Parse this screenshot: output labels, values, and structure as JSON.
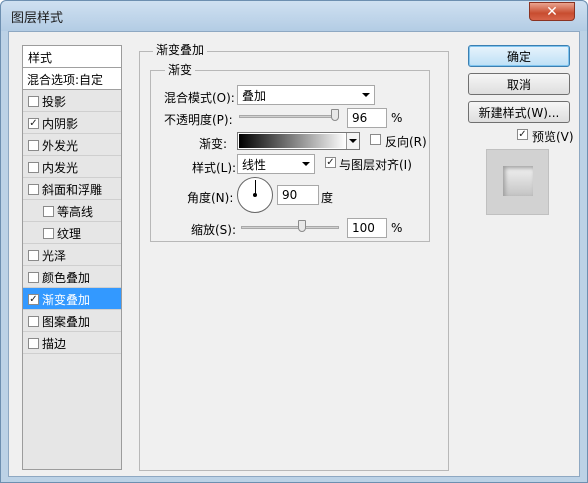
{
  "window": {
    "title": "图层样式",
    "close_glyph": "✕"
  },
  "sidebar": {
    "header": "样式",
    "blend_options": "混合选项:自定",
    "items": [
      {
        "label": "投影",
        "checked": false
      },
      {
        "label": "内阴影",
        "checked": true
      },
      {
        "label": "外发光",
        "checked": false
      },
      {
        "label": "内发光",
        "checked": false
      },
      {
        "label": "斜面和浮雕",
        "checked": false
      },
      {
        "label": "等高线",
        "checked": false
      },
      {
        "label": "纹理",
        "checked": false
      },
      {
        "label": "光泽",
        "checked": false
      },
      {
        "label": "颜色叠加",
        "checked": false
      },
      {
        "label": "渐变叠加",
        "checked": true,
        "selected": true
      },
      {
        "label": "图案叠加",
        "checked": false
      },
      {
        "label": "描边",
        "checked": false
      }
    ]
  },
  "panel": {
    "group_title": "渐变叠加",
    "subgroup_title": "渐变",
    "blend_mode_label": "混合模式(O):",
    "blend_mode_value": "叠加",
    "opacity_label": "不透明度(P):",
    "opacity_value": "96",
    "opacity_unit": "%",
    "gradient_label": "渐变:",
    "reverse_label": "反向(R)",
    "reverse_checked": false,
    "style_label": "样式(L):",
    "style_value": "线性",
    "align_label": "与图层对齐(I)",
    "align_checked": true,
    "angle_label": "角度(N):",
    "angle_value": "90",
    "angle_unit": "度",
    "scale_label": "缩放(S):",
    "scale_value": "100",
    "scale_unit": "%"
  },
  "buttons": {
    "ok": "确定",
    "cancel": "取消",
    "new_style": "新建样式(W)...",
    "preview_label": "预览(V)",
    "preview_checked": true
  },
  "check_glyph": "✓"
}
